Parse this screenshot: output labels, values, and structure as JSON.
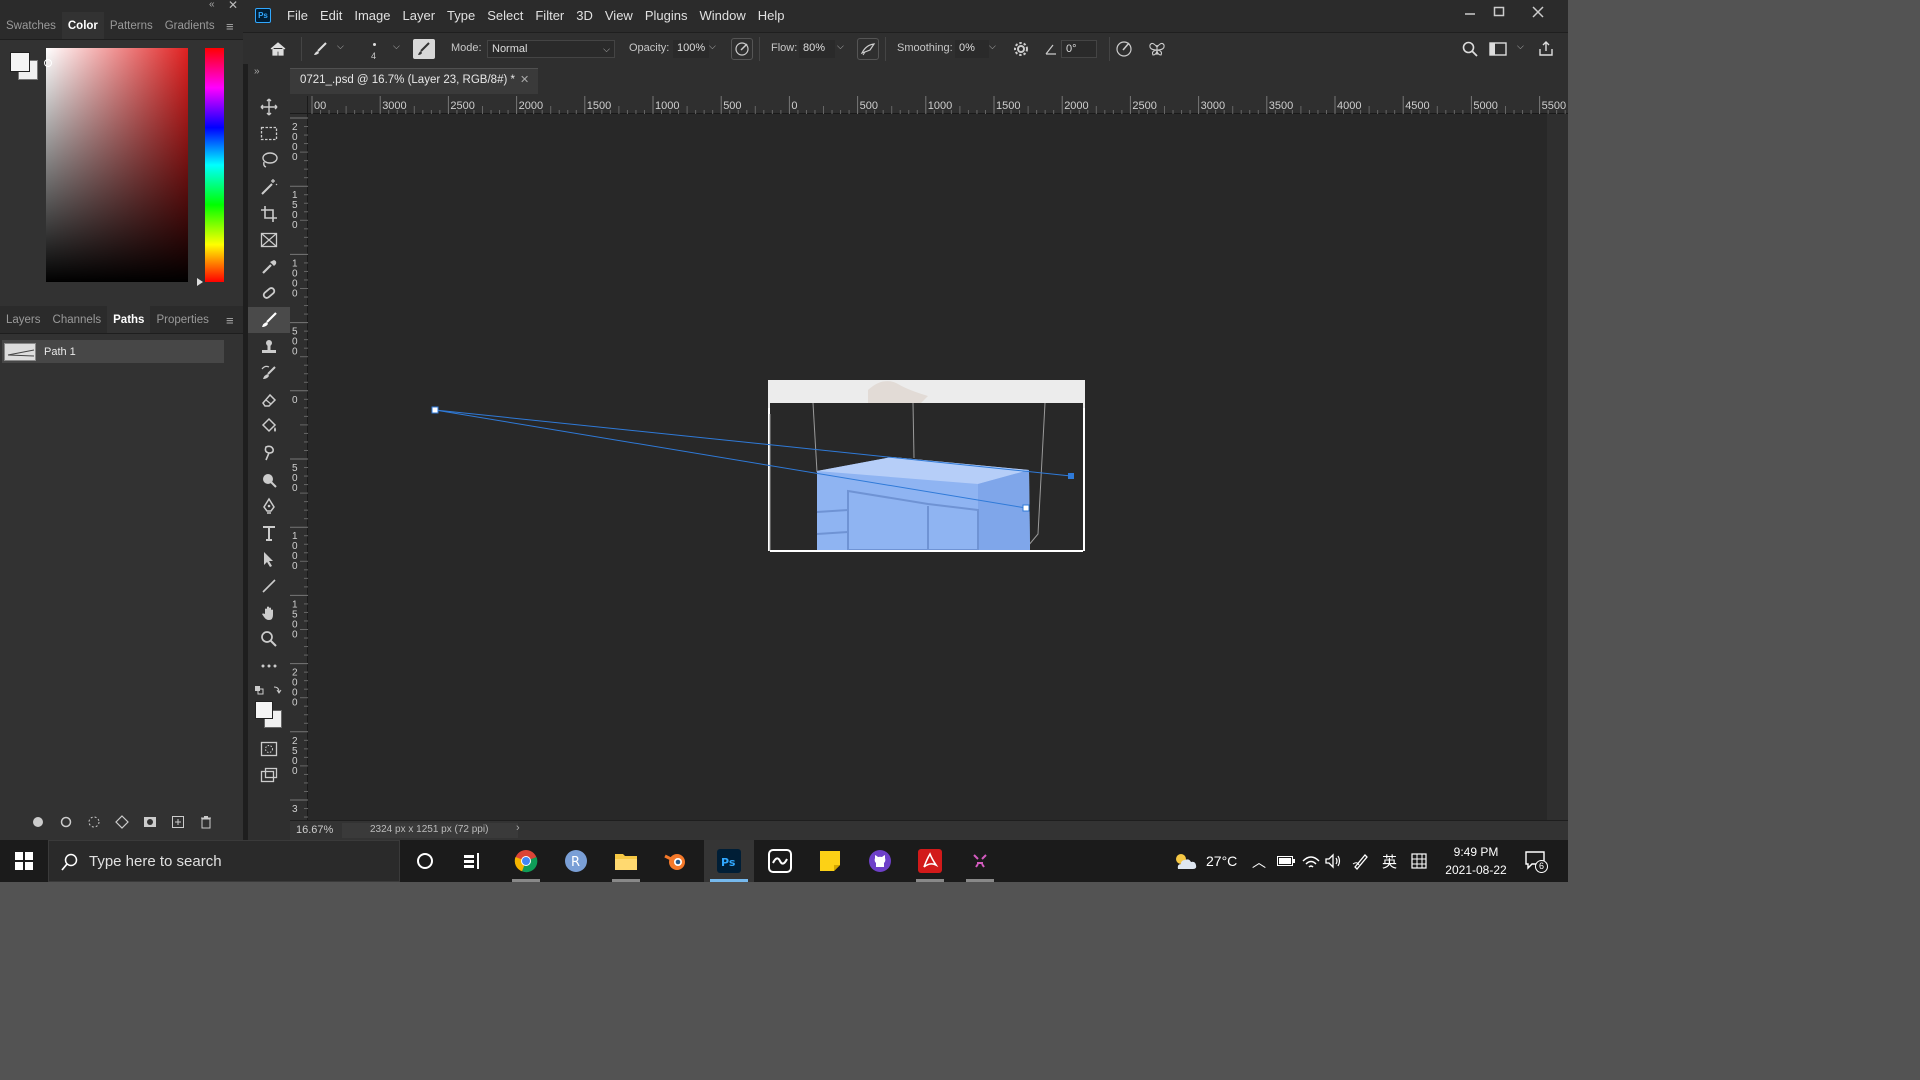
{
  "app": {
    "name": "Adobe Photoshop",
    "logo_text": "Ps"
  },
  "left_panel_top": {
    "tabs": [
      "Swatches",
      "Color",
      "Patterns",
      "Gradients"
    ],
    "active_tab": "Color"
  },
  "left_panel_bottom": {
    "tabs": [
      "Layers",
      "Channels",
      "Paths",
      "Properties"
    ],
    "active_tab": "Paths",
    "paths": [
      {
        "name": "Path 1"
      }
    ]
  },
  "menu": [
    "File",
    "Edit",
    "Image",
    "Layer",
    "Type",
    "Select",
    "Filter",
    "3D",
    "View",
    "Plugins",
    "Window",
    "Help"
  ],
  "options": {
    "brush_size": "4",
    "mode_label": "Mode:",
    "mode_value": "Normal",
    "opacity_label": "Opacity:",
    "opacity_value": "100%",
    "flow_label": "Flow:",
    "flow_value": "80%",
    "smoothing_label": "Smoothing:",
    "smoothing_value": "0%",
    "angle_value": "0°"
  },
  "document": {
    "tab_title": "0721_.psd @ 16.7% (Layer 23, RGB/8#) *",
    "zoom": "16.67%",
    "doc_size": "2324 px x 1251 px (72 ppi)"
  },
  "rulers": {
    "h_labels": [
      "00",
      "3000",
      "2500",
      "2000",
      "1500",
      "1000",
      "500",
      "0",
      "500",
      "1000",
      "1500",
      "2000",
      "2500",
      "3000",
      "3500",
      "4000",
      "4500",
      "5000",
      "5500"
    ],
    "v_labels": [
      "2\n0\n0\n0",
      "1\n5\n0\n0",
      "1\n0\n0\n0",
      "5\n0\n0",
      "0",
      "5\n0\n0",
      "1\n0\n0\n0",
      "1\n5\n0\n0",
      "2\n0\n0\n0",
      "2\n5\n0\n0",
      "3"
    ]
  },
  "taskbar": {
    "search_placeholder": "Type here to search",
    "temperature": "27°C",
    "ime": "英",
    "time": "9:49 PM",
    "date": "2021-08-22",
    "notifications": "6"
  },
  "colors": {
    "accent": "#1473e6",
    "path": "#2f7ad8",
    "cube": "#8fb4f2"
  }
}
